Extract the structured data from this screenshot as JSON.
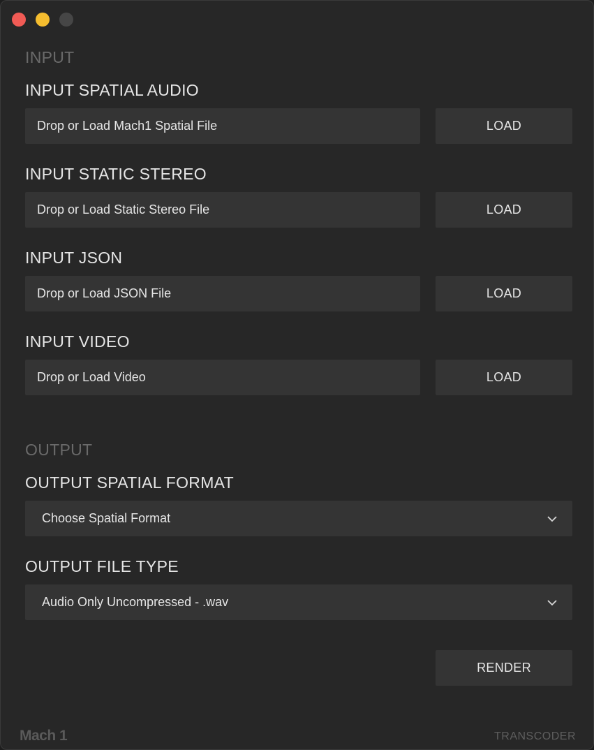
{
  "window": {
    "controls": [
      "close",
      "minimize",
      "maximize"
    ]
  },
  "input_section": {
    "title": "INPUT",
    "fields": [
      {
        "label": "INPUT SPATIAL AUDIO",
        "placeholder": "Drop or Load Mach1 Spatial File",
        "button": "LOAD"
      },
      {
        "label": "INPUT STATIC STEREO",
        "placeholder": "Drop or Load Static Stereo File",
        "button": "LOAD"
      },
      {
        "label": "INPUT JSON",
        "placeholder": "Drop or Load JSON File",
        "button": "LOAD"
      },
      {
        "label": "INPUT VIDEO",
        "placeholder": "Drop or Load Video",
        "button": "LOAD"
      }
    ]
  },
  "output_section": {
    "title": "OUTPUT",
    "spatial_format": {
      "label": "OUTPUT SPATIAL FORMAT",
      "value": "Choose Spatial Format",
      "icon": "chevron-down-icon"
    },
    "file_type": {
      "label": "OUTPUT FILE TYPE",
      "value": "Audio Only Uncompressed - .wav",
      "icon": "chevron-down-icon"
    }
  },
  "render_button": "RENDER",
  "footer": {
    "logo": "Mach 1",
    "tagline": "TRANSCODER"
  },
  "colors": {
    "background": "#272727",
    "field": "#343434",
    "text": "#e6e6e6",
    "muted": "#6a6a6a",
    "close": "#f15b55",
    "minimize": "#f5bd2f",
    "maximize_disabled": "#464646"
  }
}
